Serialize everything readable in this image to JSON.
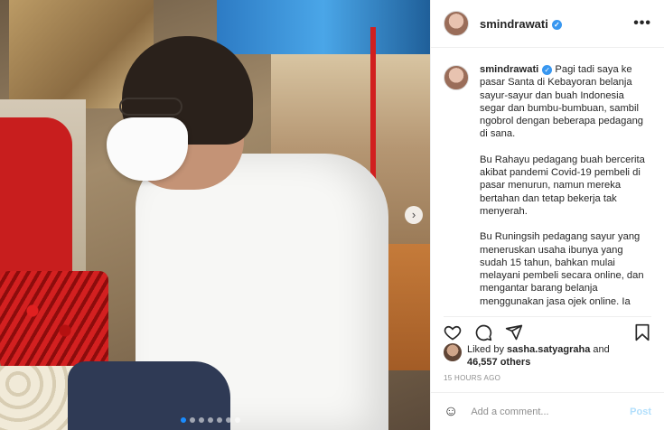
{
  "colors": {
    "accent": "#3897f0",
    "post_disabled": "#b2dffc",
    "text": "#262626",
    "muted": "#8e8e8e"
  },
  "media": {
    "carousel_next_icon": "›",
    "dot_count": 7,
    "active_dot": 0
  },
  "header": {
    "username": "smindrawati",
    "verified_icon": "✓",
    "more_icon": "•••"
  },
  "caption": {
    "username": "smindrawati",
    "paragraphs": [
      "Pagi tadi saya ke pasar Santa di Kebayoran belanja sayur-sayur dan buah Indonesia segar dan bumbu-bumbuan, sambil ngobrol dengan beberapa pedagang di sana.",
      "Bu Rahayu pedagang buah bercerita akibat pandemi Covid-19 pembeli di pasar menurun, namun mereka bertahan dan tetap bekerja tak menyerah.",
      "Bu Runingsih pedagang sayur yang meneruskan usaha ibunya yang sudah 15 tahun, bahkan mulai melayani pembeli secara online,  dan mengantar barang belanja menggunakan jasa ojek online. Ia"
    ]
  },
  "likes": {
    "prefix": "Liked by ",
    "user": "sasha.satyagraha",
    "joiner": " and",
    "others": "46,557 others"
  },
  "timestamp": "15 HOURS AGO",
  "comment": {
    "emoji_icon": "☺",
    "placeholder": "Add a comment...",
    "post_label": "Post"
  }
}
